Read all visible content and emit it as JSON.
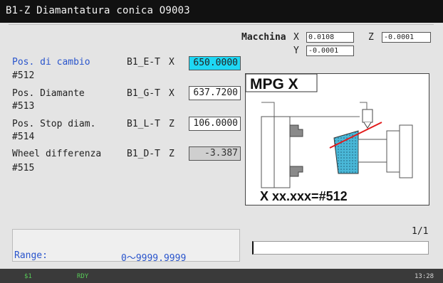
{
  "window": {
    "title": "B1-Z Diamantatura conica O9003"
  },
  "machine": {
    "label": "Macchina",
    "x_label": "X",
    "x_value": "0.0108",
    "z_label": "Z",
    "z_value": "-0.0001",
    "y_label": "Y",
    "y_value": "-0.0001"
  },
  "params": [
    {
      "name": "Pos. di cambio",
      "var": "#512",
      "code": "B1_E-T",
      "axis": "X",
      "value": "650.0000",
      "state": "active"
    },
    {
      "name": "Pos. Diamante",
      "var": "#513",
      "code": "B1_G-T",
      "axis": "X",
      "value": "637.7200",
      "state": "normal"
    },
    {
      "name": "Pos. Stop diam.",
      "var": "#514",
      "code": "B1_L-T",
      "axis": "Z",
      "value": "106.0000",
      "state": "normal"
    },
    {
      "name": "Wheel differenza",
      "var": "#515",
      "code": "B1_D-T",
      "axis": "Z",
      "value": "-3.387",
      "state": "readonly"
    }
  ],
  "diagram": {
    "title": "MPG X",
    "caption": "X xx.xxx=#512"
  },
  "footer": {
    "range_label": "Range:",
    "range_value": "0～9999.9999",
    "page": "1/1",
    "input_value": ""
  },
  "status": {
    "channel": "$1",
    "mode": "RDY",
    "time": "13:28"
  },
  "colors": {
    "active_field": "#1ed7f4",
    "label_blue": "#2a55cc",
    "diagram_red": "#e21a1a",
    "wheel": "#4ab8d8"
  }
}
